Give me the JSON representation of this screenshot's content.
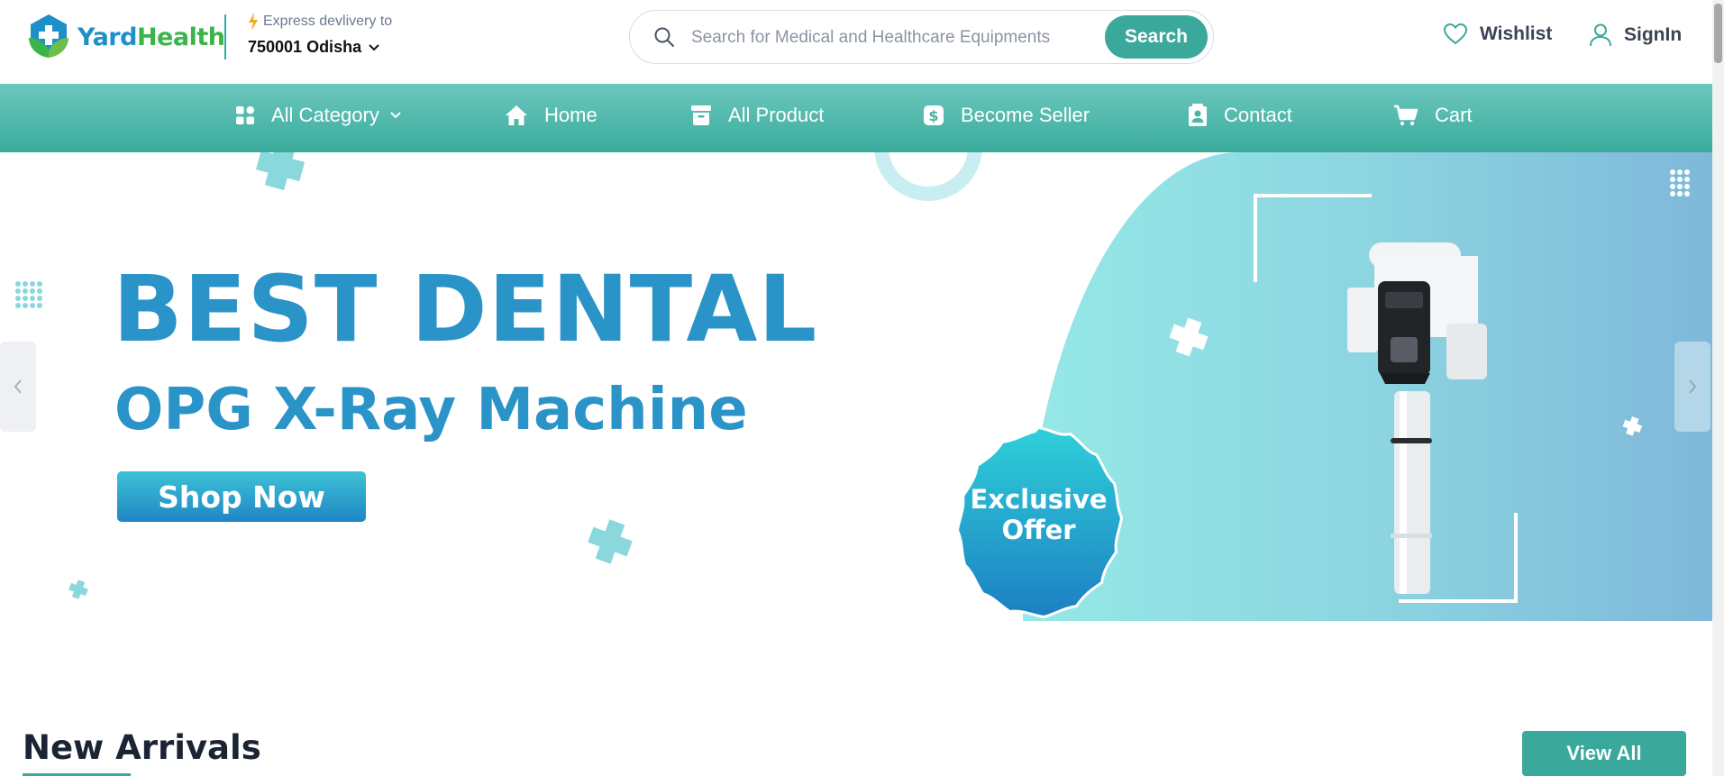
{
  "brand": {
    "name_part1": "Yard",
    "name_part2": "Health"
  },
  "delivery": {
    "label": "Express devlivery to",
    "location": "750001 Odisha"
  },
  "search": {
    "placeholder": "Search for Medical and Healthcare Equipments",
    "value": "",
    "button_label": "Search"
  },
  "header_actions": {
    "wishlist": "Wishlist",
    "signin": "SignIn"
  },
  "nav": {
    "items": [
      {
        "label": "All Category",
        "icon": "grid-icon"
      },
      {
        "label": "Home",
        "icon": "home-icon"
      },
      {
        "label": "All Product",
        "icon": "archive-icon"
      },
      {
        "label": "Become Seller",
        "icon": "dollar-icon"
      },
      {
        "label": "Contact",
        "icon": "contact-card-icon"
      },
      {
        "label": "Cart",
        "icon": "cart-icon"
      }
    ]
  },
  "hero": {
    "headline_line1": "BEST DENTAL",
    "headline_line2": "OPG X-Ray Machine",
    "cta_label": "Shop Now",
    "badge_line1": "Exclusive",
    "badge_line2": "Offer"
  },
  "section": {
    "title": "New Arrivals",
    "view_all_label": "View All"
  },
  "colors": {
    "primary_teal": "#3aa99b",
    "hero_blue": "#2a93c8",
    "brand_blue": "#1e90c9",
    "brand_green": "#3bb54a"
  }
}
